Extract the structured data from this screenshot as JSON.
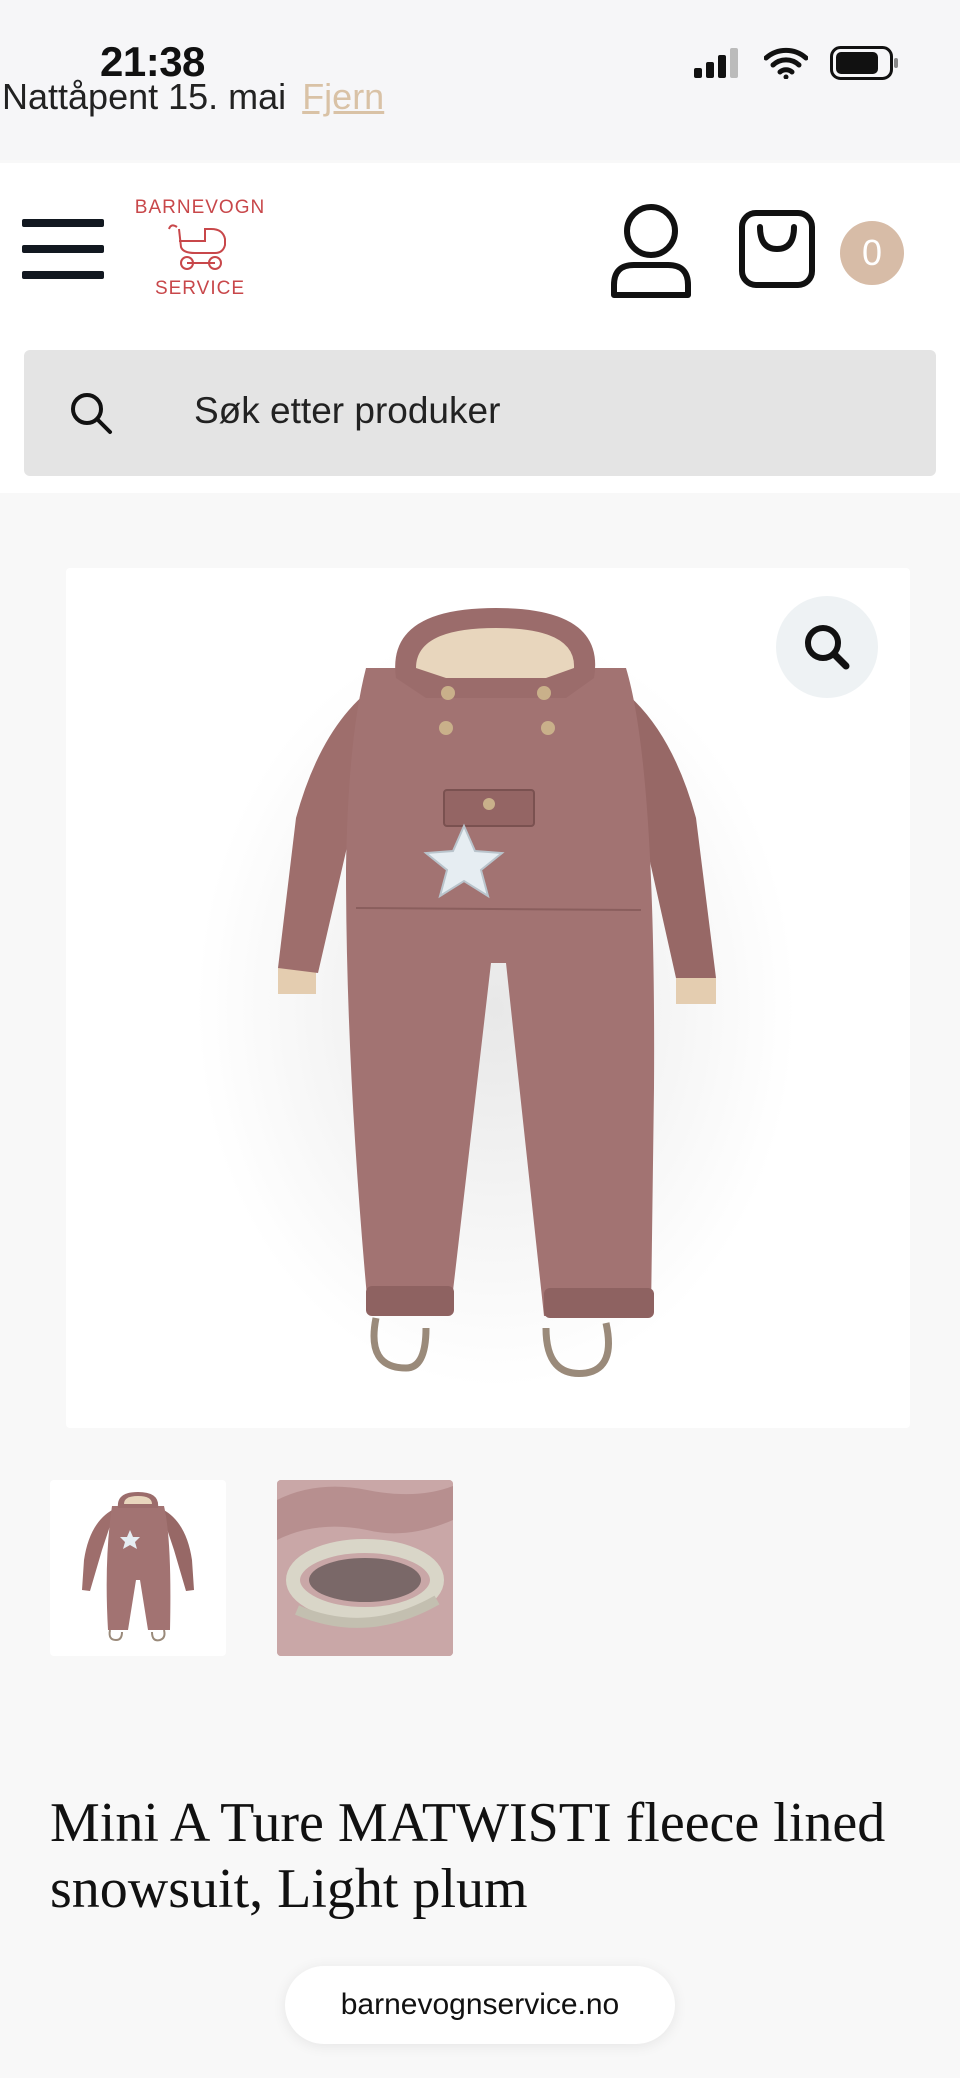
{
  "status_bar": {
    "time": "21:38"
  },
  "notice": {
    "text": "Nattåpent 15. mai",
    "link": "Fjern"
  },
  "header": {
    "logo_top": "BARNEVOGN",
    "logo_bottom": "SERVICE",
    "cart_count": "0"
  },
  "search": {
    "placeholder": "Søk etter produker"
  },
  "product": {
    "title": "Mini A Ture MATWISTI fleece lined snowsuit, Light plum",
    "color": "#9e6e6c"
  },
  "browser": {
    "url": "barnevognservice.no"
  }
}
